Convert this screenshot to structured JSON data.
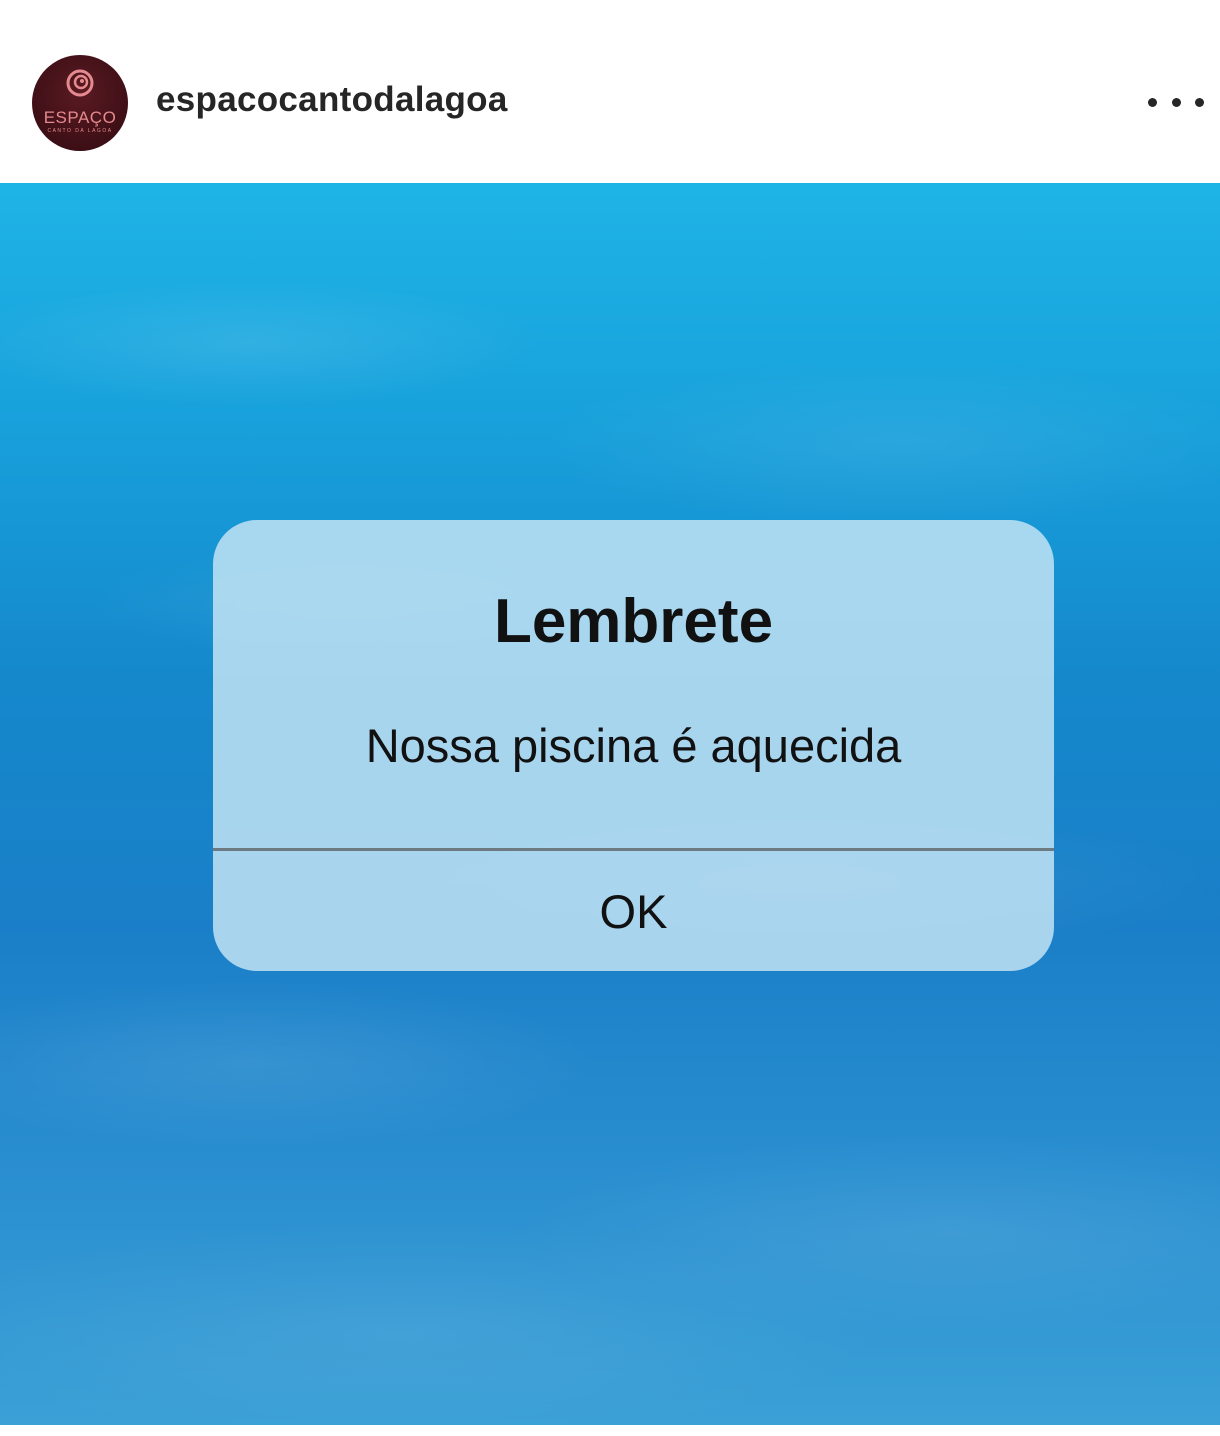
{
  "header": {
    "username": "espacocantodalagoa",
    "avatar": {
      "logo_text": "ESPAÇO",
      "logo_subtext": "CANTO DA LAGOA",
      "brand_color": "#e58a8f",
      "background_color": "#3e0f16"
    },
    "more_icon": "more-horizontal-icon"
  },
  "post": {
    "alert": {
      "title": "Lembrete",
      "message": "Nossa piscina é aquecida",
      "button_label": "OK"
    }
  }
}
